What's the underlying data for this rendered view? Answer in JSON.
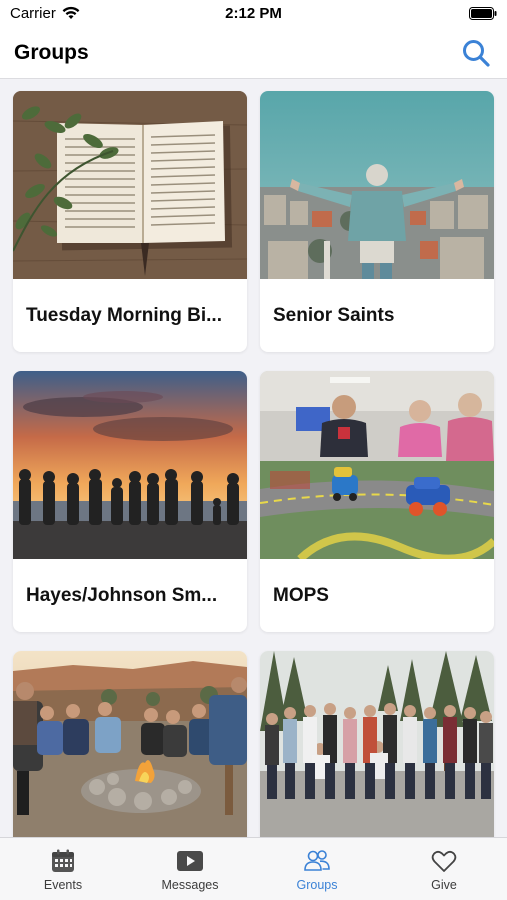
{
  "status_bar": {
    "carrier": "Carrier",
    "time": "2:12 PM"
  },
  "nav": {
    "title": "Groups",
    "search_icon": "search-icon"
  },
  "groups": [
    {
      "name": "Tuesday Morning Bi...",
      "image": "open-bible-on-wood"
    },
    {
      "name": "Senior Saints",
      "image": "person-arms-outstretched-over-city"
    },
    {
      "name": "Hayes/Johnson Sm...",
      "image": "group-silhouette-at-sunset-beach"
    },
    {
      "name": "MOPS",
      "image": "kids-playing-with-toy-cars"
    },
    {
      "name": "",
      "image": "people-around-campfire"
    },
    {
      "name": "",
      "image": "large-group-photo-in-forest"
    }
  ],
  "tabs": [
    {
      "label": "Events",
      "icon": "calendar-icon",
      "active": false
    },
    {
      "label": "Messages",
      "icon": "play-icon",
      "active": false
    },
    {
      "label": "Groups",
      "icon": "people-icon",
      "active": true
    },
    {
      "label": "Give",
      "icon": "heart-icon",
      "active": false
    }
  ],
  "colors": {
    "accent": "#3b82d6",
    "background": "#f2f2f6",
    "card": "#ffffff"
  }
}
